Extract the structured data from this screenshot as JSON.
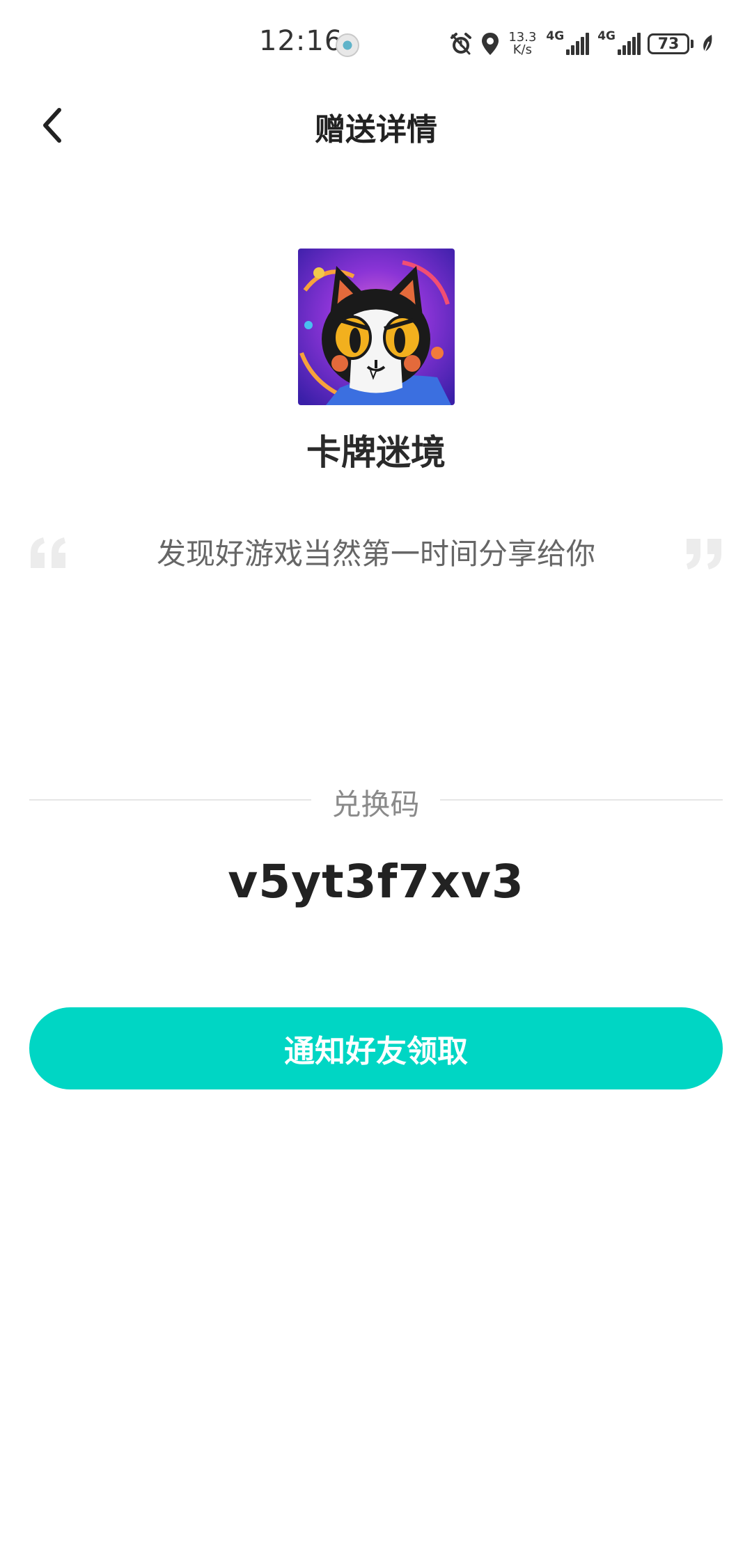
{
  "status_bar": {
    "time": "12:16",
    "net_speed_value": "13.3",
    "net_speed_unit": "K/s",
    "sim1_gen": "4G",
    "sim2_gen": "4G",
    "battery": "73",
    "icons": [
      "alarm-icon",
      "location-icon",
      "signal-icon",
      "battery-icon",
      "leaf-icon"
    ]
  },
  "header": {
    "title": "赠送详情"
  },
  "game": {
    "name": "卡牌迷境",
    "icon": "game-cat-icon"
  },
  "message": {
    "text": "发现好游戏当然第一时间分享给你"
  },
  "redeem": {
    "label": "兑换码",
    "code": "v5yt3f7xv3"
  },
  "actions": {
    "notify_label": "通知好友领取"
  },
  "colors": {
    "accent": "#00d6c4",
    "title_text": "#222222",
    "secondary_text": "#666666",
    "label_text": "#8a8a8a",
    "quote_mark": "#ececec"
  }
}
